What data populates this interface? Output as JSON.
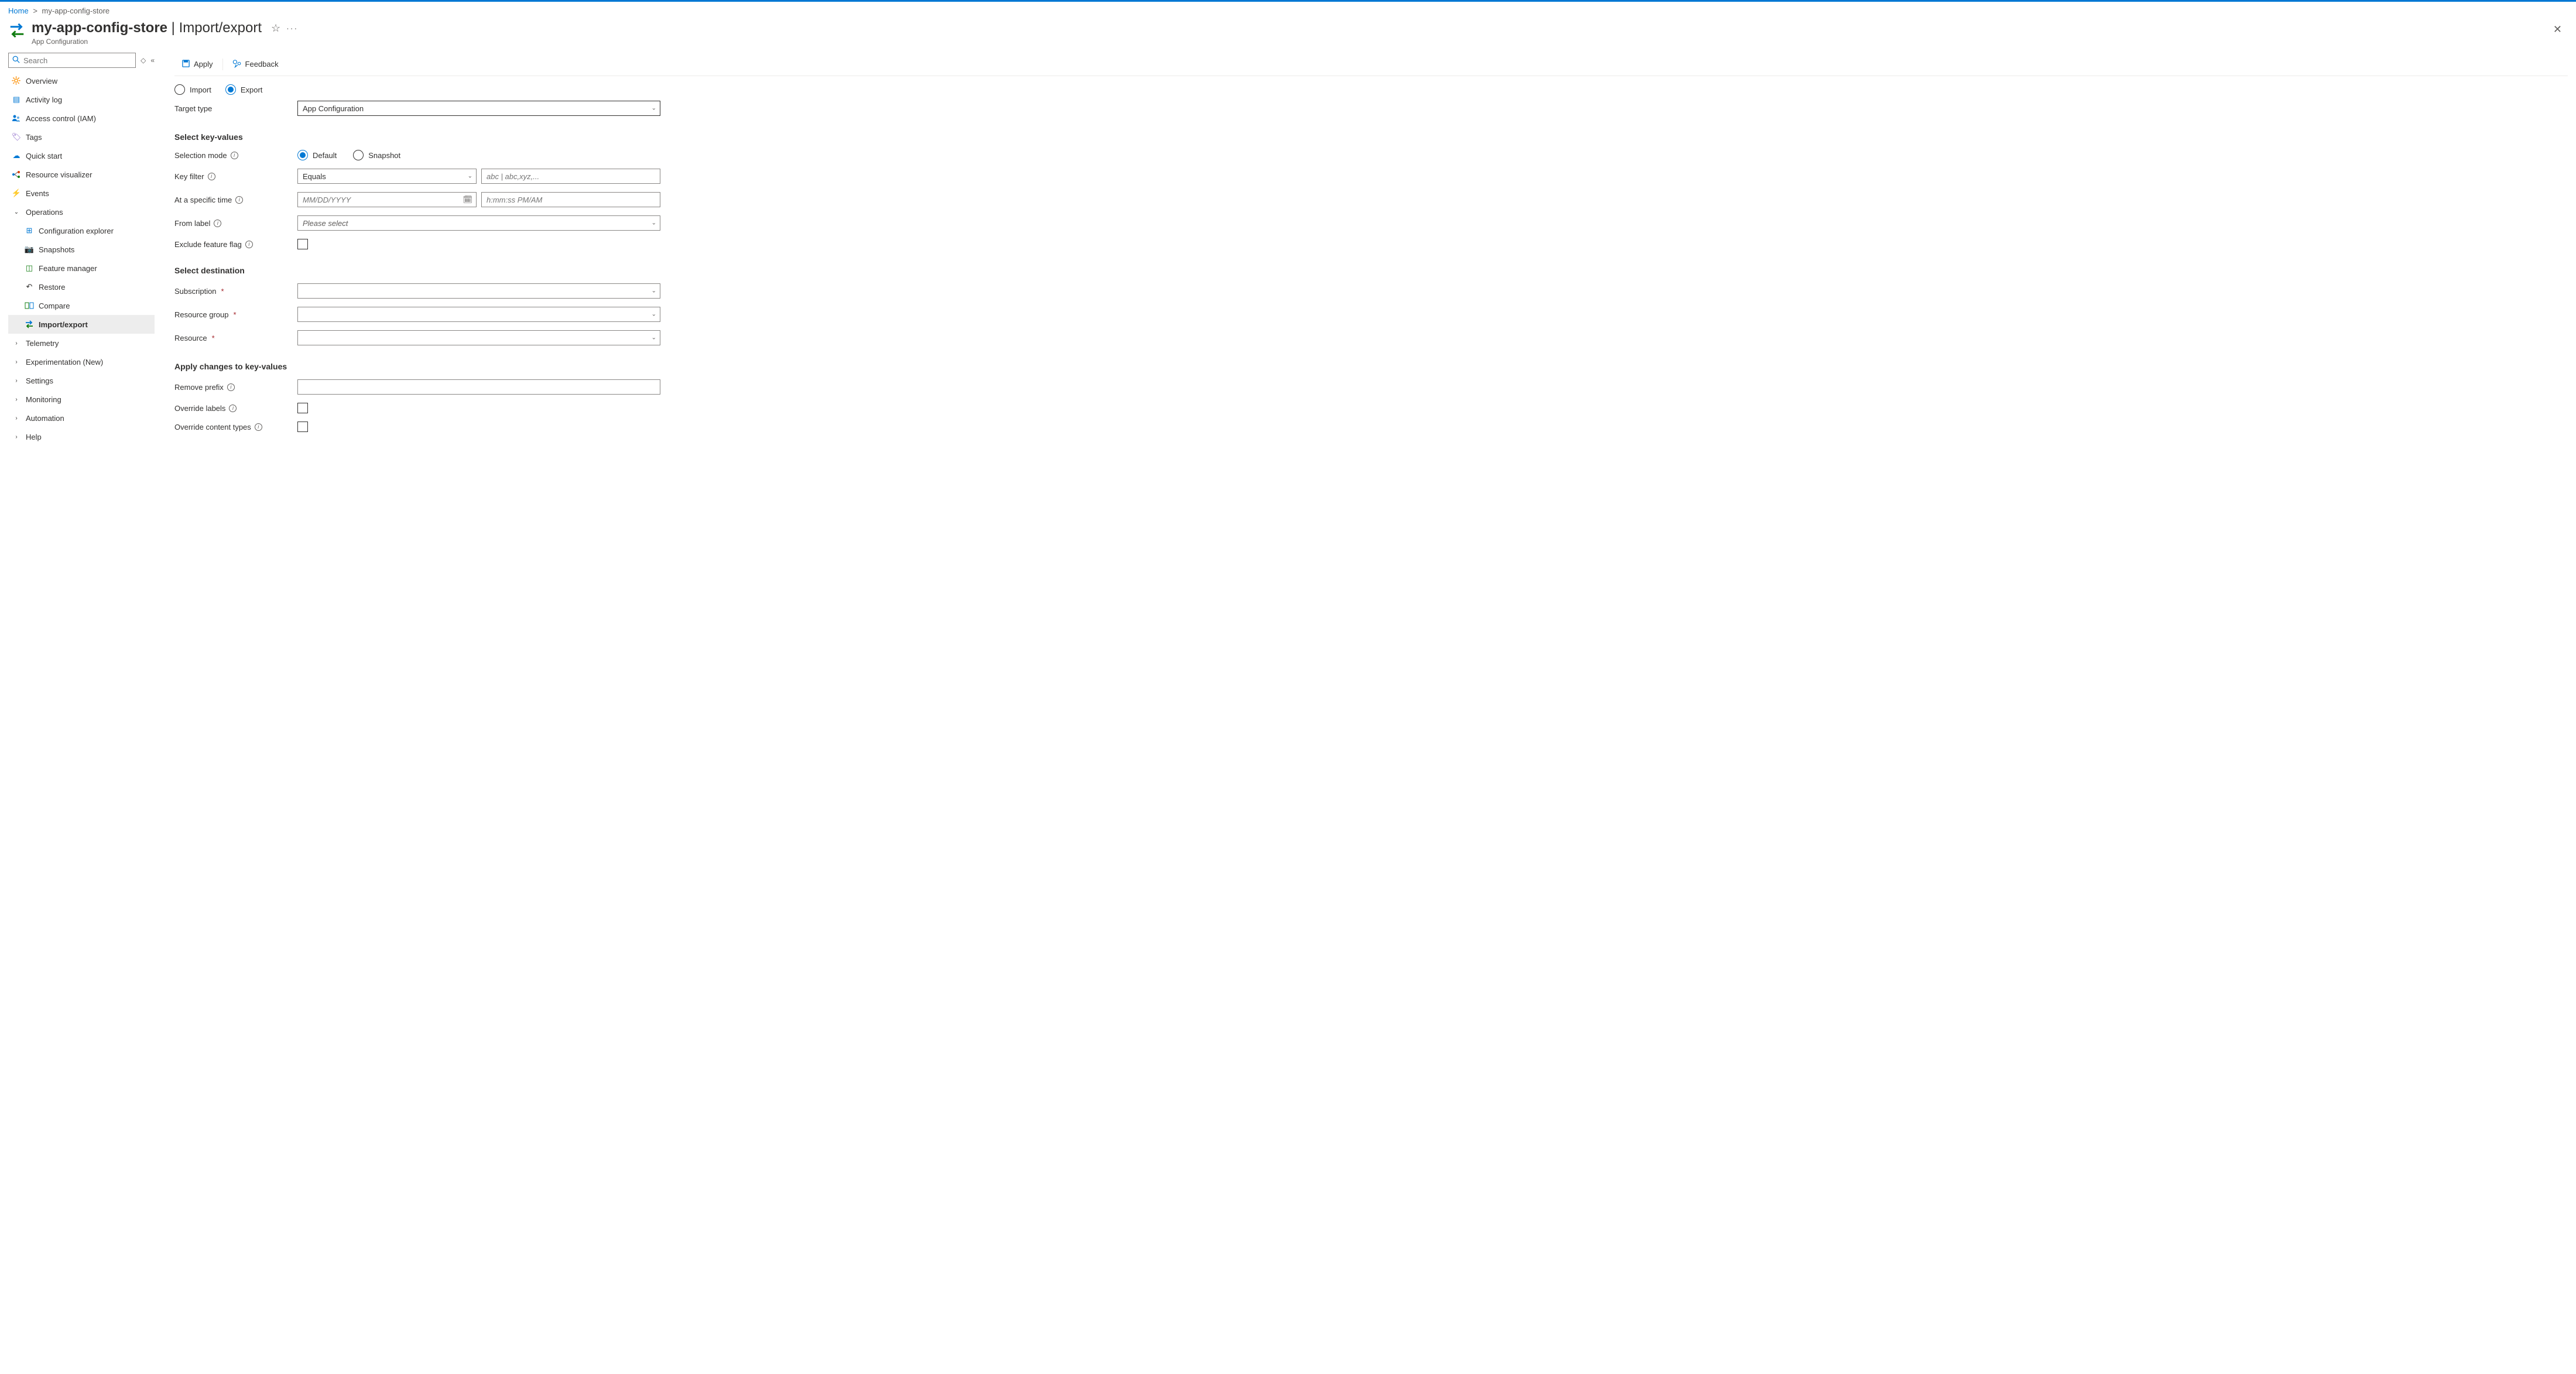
{
  "breadcrumb": {
    "home": "Home",
    "resource": "my-app-config-store"
  },
  "header": {
    "title_main": "my-app-config-store",
    "title_sep": " | ",
    "title_sub": "Import/export",
    "subtitle": "App Configuration"
  },
  "sidebar": {
    "search_placeholder": "Search",
    "items": [
      {
        "label": "Overview"
      },
      {
        "label": "Activity log"
      },
      {
        "label": "Access control (IAM)"
      },
      {
        "label": "Tags"
      },
      {
        "label": "Quick start"
      },
      {
        "label": "Resource visualizer"
      },
      {
        "label": "Events"
      }
    ],
    "operations": {
      "label": "Operations",
      "children": [
        {
          "label": "Configuration explorer"
        },
        {
          "label": "Snapshots"
        },
        {
          "label": "Feature manager"
        },
        {
          "label": "Restore"
        },
        {
          "label": "Compare"
        },
        {
          "label": "Import/export"
        }
      ]
    },
    "groups": [
      {
        "label": "Telemetry"
      },
      {
        "label": "Experimentation (New)"
      },
      {
        "label": "Settings"
      },
      {
        "label": "Monitoring"
      },
      {
        "label": "Automation"
      },
      {
        "label": "Help"
      }
    ]
  },
  "toolbar": {
    "apply": "Apply",
    "feedback": "Feedback"
  },
  "mode": {
    "import": "Import",
    "export": "Export"
  },
  "form": {
    "target_type_label": "Target type",
    "target_type_value": "App Configuration",
    "section_keyvalues": "Select key-values",
    "selection_mode_label": "Selection mode",
    "selection_default": "Default",
    "selection_snapshot": "Snapshot",
    "key_filter_label": "Key filter",
    "key_filter_value": "Equals",
    "key_filter_placeholder": "abc | abc,xyz,...",
    "time_label": "At a specific time",
    "time_date_placeholder": "MM/DD/YYYY",
    "time_time_placeholder": "h:mm:ss PM/AM",
    "from_label_label": "From label",
    "from_label_placeholder": "Please select",
    "exclude_ff_label": "Exclude feature flag",
    "section_destination": "Select destination",
    "subscription_label": "Subscription",
    "rg_label": "Resource group",
    "resource_label": "Resource",
    "section_apply": "Apply changes to key-values",
    "remove_prefix_label": "Remove prefix",
    "override_labels_label": "Override labels",
    "override_ct_label": "Override content types"
  }
}
